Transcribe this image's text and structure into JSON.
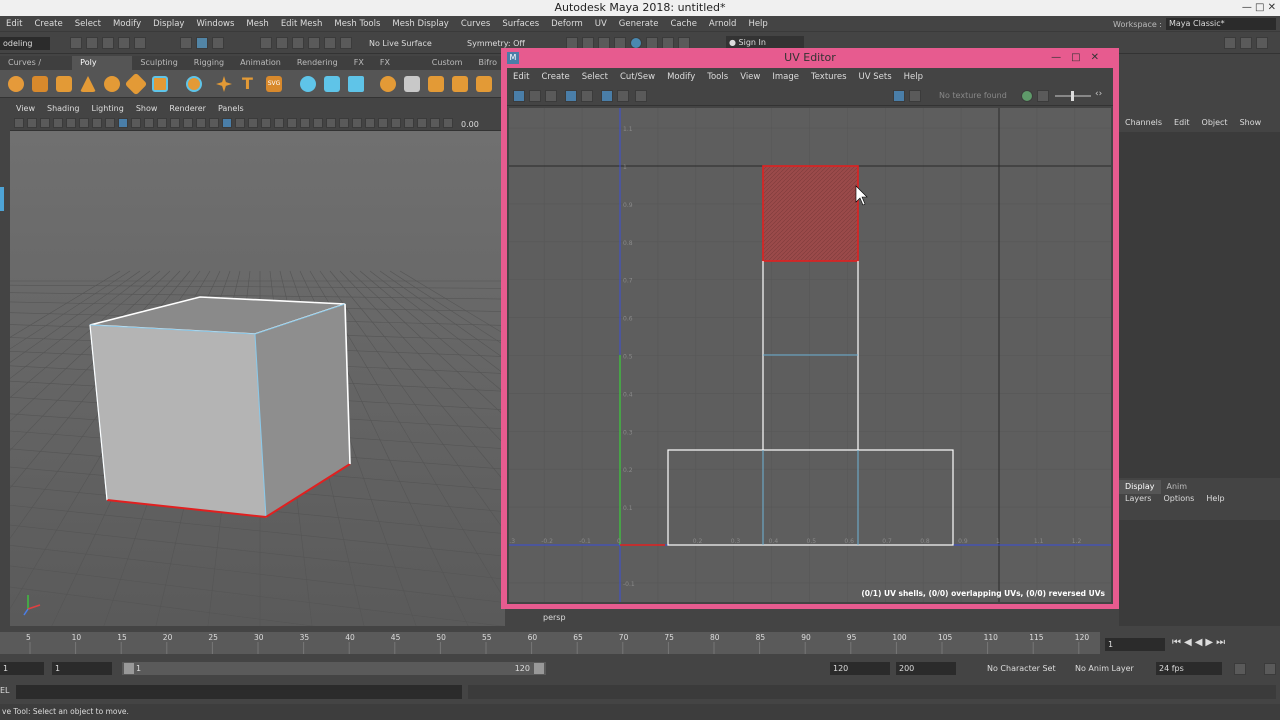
{
  "app": {
    "title": "Autodesk Maya 2018: untitled*",
    "window_controls": "—  □  ✕"
  },
  "menubar": [
    "Edit",
    "Create",
    "Select",
    "Modify",
    "Display",
    "Windows",
    "Mesh",
    "Edit Mesh",
    "Mesh Tools",
    "Mesh Display",
    "Curves",
    "Surfaces",
    "Deform",
    "UV",
    "Generate",
    "Cache",
    "Arnold",
    "Help"
  ],
  "workspace": {
    "label": "Workspace :",
    "value": "Maya Classic*"
  },
  "statusline": {
    "mode": "odeling",
    "live_surface": "No Live Surface",
    "symmetry": "Symmetry: Off",
    "sign_in": "Sign In"
  },
  "shelf_tabs": [
    "Curves / Surfaces",
    "Poly Modeling",
    "Sculpting",
    "Rigging",
    "Animation",
    "Rendering",
    "FX",
    "FX Caching",
    "Custom",
    "Bifro"
  ],
  "shelf_active": "Poly Modeling",
  "viewport": {
    "menu": [
      "View",
      "Shading",
      "Lighting",
      "Show",
      "Renderer",
      "Panels"
    ],
    "field_value": "0.00",
    "camera_label": "persp"
  },
  "uv_editor": {
    "title": "UV Editor",
    "menu": [
      "Edit",
      "Create",
      "Select",
      "Cut/Sew",
      "Modify",
      "Tools",
      "View",
      "Image",
      "Textures",
      "UV Sets",
      "Help"
    ],
    "texture_label": "No texture found",
    "status": "(0/1) UV shells, (0/0) overlapping UVs, (0/0) reversed UVs",
    "axis_v_labels": [
      "1.1",
      "1",
      "0.9",
      "0.8",
      "0.7",
      "0.6",
      "0.5",
      "0.4",
      "0.3",
      "0.2",
      "0.1",
      "-0.1"
    ],
    "axis_u_labels": [
      "-0.3",
      "-0.2",
      "-0.1",
      "0",
      "0.2",
      "0.3",
      "0.4",
      "0.5",
      "0.6",
      "0.7",
      "0.8",
      "0.9",
      "1",
      "1.1",
      "1.2"
    ],
    "colors": {
      "frame": "#e75b8f",
      "selected_face": "#9a4a4a",
      "selected_edge": "#e02020",
      "shell_edge": "#ffffff",
      "inner_edge": "#6fb4d8"
    }
  },
  "channel_box": {
    "menu": [
      "Channels",
      "Edit",
      "Object",
      "Show"
    ]
  },
  "layer_editor": {
    "tabs": [
      "Display",
      "Anim"
    ],
    "active": "Display",
    "menu": [
      "Layers",
      "Options",
      "Help"
    ]
  },
  "timeline": {
    "ticks": [
      "5",
      "10",
      "15",
      "20",
      "25",
      "30",
      "35",
      "40",
      "45",
      "50",
      "55",
      "60",
      "65",
      "70",
      "75",
      "80",
      "85",
      "90",
      "95",
      "100",
      "105",
      "110",
      "115",
      "120"
    ],
    "current_frame": "1"
  },
  "range": {
    "start": "1",
    "inner_start": "1",
    "inner_end": "120",
    "end": "120",
    "anim_end": "200",
    "character_set": "No Character Set",
    "anim_layer": "No Anim Layer",
    "fps": "24 fps"
  },
  "cmdline": {
    "lang": "EL"
  },
  "helpline": "ve Tool: Select an object to move."
}
